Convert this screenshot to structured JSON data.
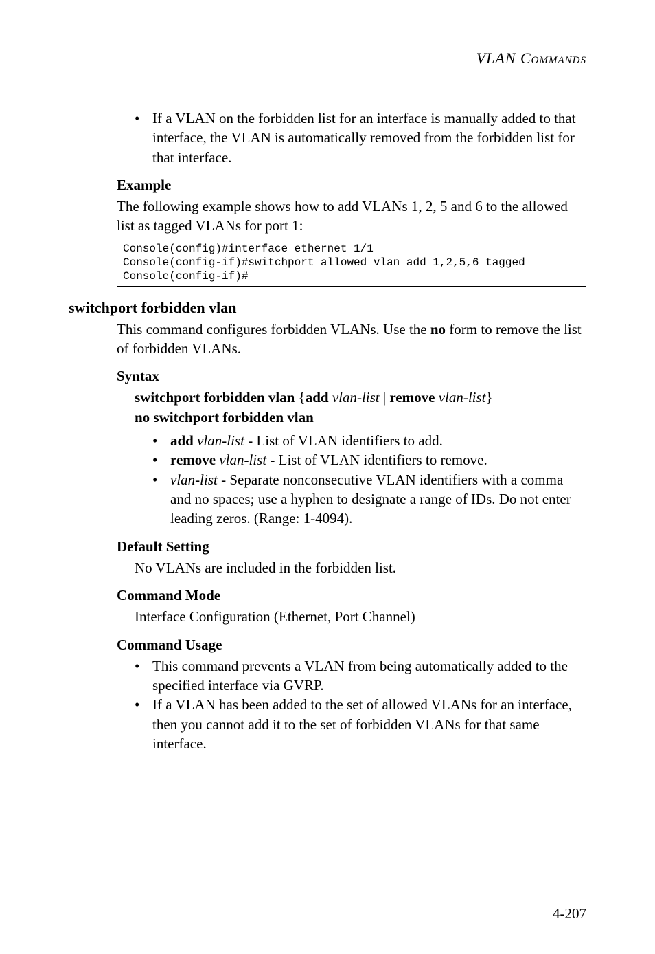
{
  "header": {
    "title": "VLAN Commands"
  },
  "intro": {
    "bullet": "If a VLAN on the forbidden list for an interface is manually added to that interface, the VLAN is automatically removed from the forbidden list for that interface."
  },
  "example": {
    "heading": "Example",
    "text": "The following example shows how to add VLANs 1, 2, 5 and 6 to the allowed list as tagged VLANs for port 1:",
    "code": [
      "Console(config)#interface ethernet 1/1",
      "Console(config-if)#switchport allowed vlan add 1,2,5,6 tagged",
      "Console(config-if)#"
    ]
  },
  "command": {
    "heading": "switchport forbidden vlan",
    "desc_pre": "This command configures forbidden VLANs. Use the ",
    "desc_bold": "no",
    "desc_post": " form to remove the list of forbidden VLANs."
  },
  "syntax": {
    "heading": "Syntax",
    "line1": {
      "b1": "switchport forbidden vlan",
      "p1": " {",
      "b2": "add",
      "p2": " ",
      "i1": "vlan-list",
      "p3": " | ",
      "b3": "remove",
      "p4": " ",
      "i2": "vlan-list",
      "p5": "}"
    },
    "line2": "no switchport forbidden vlan",
    "bullets": [
      {
        "bold": "add",
        "sp": " ",
        "italic": "vlan-list",
        "rest": " - List of VLAN identifiers to add."
      },
      {
        "bold": "remove",
        "sp": " ",
        "italic": "vlan-list",
        "rest": " - List of VLAN identifiers to remove."
      },
      {
        "bold": "",
        "sp": "",
        "italic": "vlan-list",
        "rest": " - Separate nonconsecutive VLAN identifiers with a comma and no spaces; use a hyphen to designate a range of IDs. Do not enter leading zeros. (Range: 1-4094)."
      }
    ]
  },
  "default_setting": {
    "heading": "Default Setting",
    "text": "No VLANs are included in the forbidden list."
  },
  "command_mode": {
    "heading": "Command Mode",
    "text": "Interface Configuration (Ethernet, Port Channel)"
  },
  "command_usage": {
    "heading": "Command Usage",
    "bullets": [
      "This command prevents a VLAN from being automatically added to the specified interface via GVRP.",
      "If a VLAN has been added to the set of allowed VLANs for an interface, then you cannot add it to the set of forbidden VLANs for that same interface."
    ]
  },
  "footer": {
    "page": "4-207"
  }
}
